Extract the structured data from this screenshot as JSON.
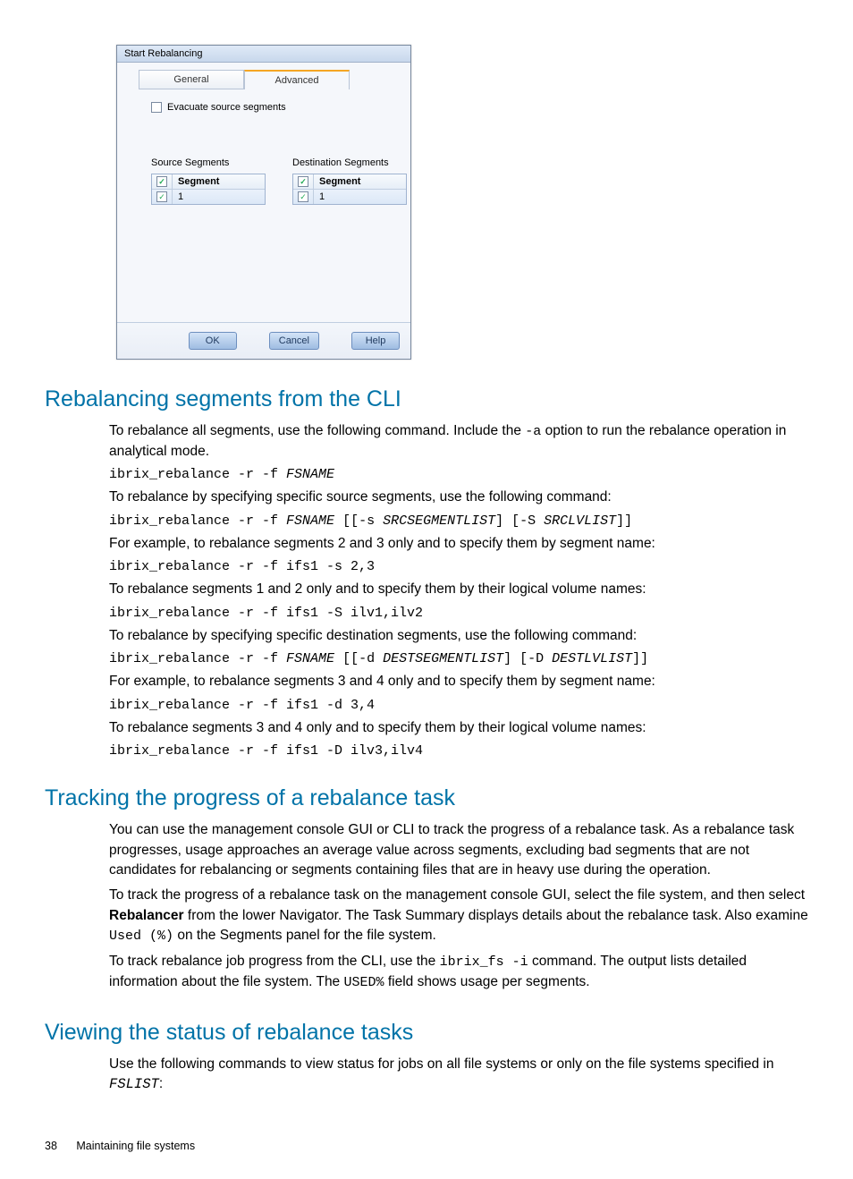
{
  "dialog": {
    "title": "Start Rebalancing",
    "tabs": {
      "general": "General",
      "advanced": "Advanced"
    },
    "evacuate_label": "Evacuate source segments",
    "source_title": "Source Segments",
    "dest_title": "Destination Segments",
    "col_header": "Segment",
    "row_value": "1",
    "buttons": {
      "ok": "OK",
      "cancel": "Cancel",
      "help": "Help"
    }
  },
  "sections": {
    "s1": {
      "title": "Rebalancing segments from the CLI",
      "p1a": "To rebalance all segments, use the following command. Include the ",
      "p1_opt": "-a",
      "p1b": " option to run the rebalance operation in analytical mode.",
      "cmd1_pre": "ibrix_rebalance -r -f ",
      "cmd1_arg": "FSNAME",
      "p2": "To rebalance by specifying specific source segments, use the following command:",
      "cmd2_pre": "ibrix_rebalance -r -f ",
      "cmd2_a1": "FSNAME",
      "cmd2_mid1": " [[-s ",
      "cmd2_a2": "SRCSEGMENTLIST",
      "cmd2_mid2": "] [-S ",
      "cmd2_a3": "SRCLVLIST",
      "cmd2_end": "]]",
      "p3": "For example, to rebalance segments 2 and 3 only and to specify them by segment name:",
      "cmd3": "ibrix_rebalance -r -f ifs1 -s 2,3",
      "p4": "To rebalance segments 1 and 2 only and to specify them by their logical volume names:",
      "cmd4": "ibrix_rebalance -r -f ifs1 -S ilv1,ilv2",
      "p5": "To rebalance by specifying specific destination segments, use the following command:",
      "cmd5_pre": "ibrix_rebalance -r -f ",
      "cmd5_a1": "FSNAME",
      "cmd5_mid1": " [[-d ",
      "cmd5_a2": "DESTSEGMENTLIST",
      "cmd5_mid2": "] [-D ",
      "cmd5_a3": "DESTLVLIST",
      "cmd5_end": "]]",
      "p6": "For example, to rebalance segments 3 and 4 only and to specify them by segment name:",
      "cmd6": "ibrix_rebalance -r -f ifs1 -d 3,4",
      "p7": "To rebalance segments 3 and 4 only and to specify them by their logical volume names:",
      "cmd7": "ibrix_rebalance -r -f ifs1 -D ilv3,ilv4"
    },
    "s2": {
      "title": "Tracking the progress of a rebalance task",
      "p1": "You can use the management console GUI or CLI to track the progress of a rebalance task. As a rebalance task progresses, usage approaches an average value across segments, excluding bad segments that are not candidates for rebalancing or segments containing files that are in heavy use during the operation.",
      "p2a": "To track the progress of a rebalance task on the management console GUI, select the file system, and then select ",
      "p2_bold": "Rebalancer",
      "p2b": " from the lower Navigator. The Task Summary displays details about the rebalance task. Also examine ",
      "p2_code": "Used (%)",
      "p2c": " on the Segments panel for the file system.",
      "p3a": "To track rebalance job progress from the CLI, use the ",
      "p3_code1": "ibrix_fs -i",
      "p3b": " command. The output lists detailed information about the file system. The ",
      "p3_code2": "USED%",
      "p3c": " field shows usage per segments."
    },
    "s3": {
      "title": "Viewing the status of rebalance tasks",
      "p1a": "Use the following commands to view status for jobs on all file systems or only on the file systems specified in ",
      "p1_arg": "FSLIST",
      "p1b": ":"
    }
  },
  "footer": {
    "page": "38",
    "chapter": "Maintaining file systems"
  }
}
